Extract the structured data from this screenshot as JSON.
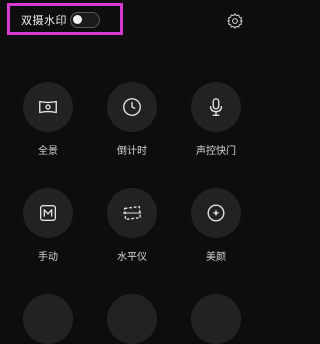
{
  "top_bar": {
    "dual_watermark_label": "双摄水印",
    "dual_watermark_enabled": false,
    "settings_icon": "gear-icon",
    "highlight_color": "#d63ad0"
  },
  "modes": [
    {
      "label": "全景",
      "icon": "panorama-icon"
    },
    {
      "label": "倒计时",
      "icon": "timer-icon"
    },
    {
      "label": "声控快门",
      "icon": "microphone-icon"
    },
    {
      "label": "手动",
      "icon": "manual-m-icon"
    },
    {
      "label": "水平仪",
      "icon": "level-icon"
    },
    {
      "label": "美颜",
      "icon": "beauty-icon"
    }
  ]
}
